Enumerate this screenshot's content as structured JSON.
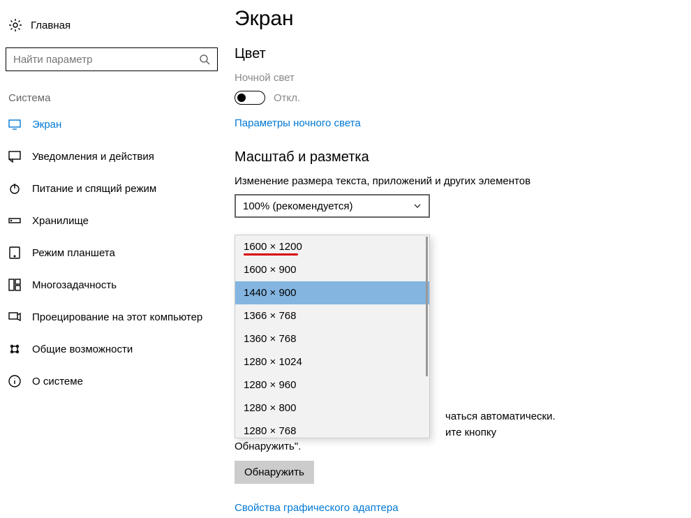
{
  "sidebar": {
    "home_label": "Главная",
    "search_placeholder": "Найти параметр",
    "section_label": "Система",
    "items": [
      {
        "label": "Экран",
        "icon": "display-icon",
        "active": true
      },
      {
        "label": "Уведомления и действия",
        "icon": "notification-icon"
      },
      {
        "label": "Питание и спящий режим",
        "icon": "power-icon"
      },
      {
        "label": "Хранилище",
        "icon": "storage-icon"
      },
      {
        "label": "Режим планшета",
        "icon": "tablet-icon"
      },
      {
        "label": "Многозадачность",
        "icon": "multitask-icon"
      },
      {
        "label": "Проецирование на этот компьютер",
        "icon": "project-icon"
      },
      {
        "label": "Общие возможности",
        "icon": "shared-icon"
      },
      {
        "label": "О системе",
        "icon": "info-icon"
      }
    ]
  },
  "main": {
    "title": "Экран",
    "color_heading": "Цвет",
    "night_light_label": "Ночной свет",
    "toggle_state": "Откл.",
    "night_light_link": "Параметры ночного света",
    "scale_heading": "Масштаб и разметка",
    "scale_field_label": "Изменение размера текста, приложений и других элементов",
    "scale_value": "100% (рекомендуется)",
    "resolution_options": [
      "1600 × 1200",
      "1600 × 900",
      "1440 × 900",
      "1366 × 768",
      "1360 × 768",
      "1280 × 1024",
      "1280 × 960",
      "1280 × 800",
      "1280 × 768"
    ],
    "selected_resolution_index": 2,
    "underlined_resolution_index": 0,
    "partial_text_1": "чаться автоматически.",
    "partial_text_2": "ите кнопку",
    "partial_text_3": "Обнаружить\".",
    "detect_button": "Обнаружить",
    "adapter_link": "Свойства графического адаптера"
  }
}
